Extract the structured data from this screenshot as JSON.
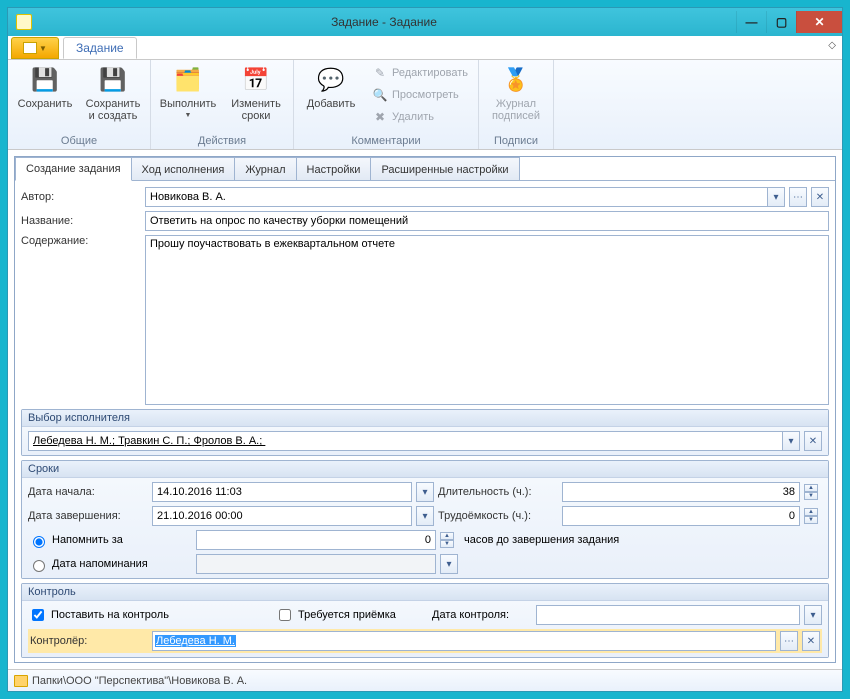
{
  "title": "Задание - Задание",
  "ribbon_tab": "Задание",
  "ribbon": {
    "save": "Сохранить",
    "save_create": "Сохранить\nи создать",
    "group_common": "Общие",
    "execute": "Выполнить",
    "change_dates": "Изменить\nсроки",
    "group_actions": "Действия",
    "add": "Добавить",
    "edit": "Редактировать",
    "view": "Просмотреть",
    "delete": "Удалить",
    "group_comments": "Комментарии",
    "siglog": "Журнал\nподписей",
    "group_sign": "Подписи"
  },
  "tabs": [
    "Создание задания",
    "Ход исполнения",
    "Журнал",
    "Настройки",
    "Расширенные настройки"
  ],
  "form": {
    "author_label": "Автор:",
    "author_value": "Новикова В. А.",
    "name_label": "Название:",
    "name_value": "Ответить на опрос по качеству уборки помещений",
    "content_label": "Содержание:",
    "content_value": "Прошу поучаствовать в ежеквартальном отчете"
  },
  "performers": {
    "title": "Выбор исполнителя",
    "value": "Лебедева Н. М.; Травкин С. П.; Фролов В. А.; "
  },
  "dates": {
    "title": "Сроки",
    "start_label": "Дата начала:",
    "start_value": "14.10.2016 11:03",
    "end_label": "Дата завершения:",
    "end_value": "21.10.2016 00:00",
    "duration_label": "Длительность (ч.):",
    "duration_value": "38",
    "labor_label": "Трудоёмкость (ч.):",
    "labor_value": "0",
    "remind_before": "Напомнить за",
    "remind_value": "0",
    "remind_suffix": "часов до завершения задания",
    "remind_date": "Дата напоминания"
  },
  "control": {
    "title": "Контроль",
    "put": "Поставить на контроль",
    "accept": "Требуется приёмка",
    "date_label": "Дата контроля:",
    "controller_label": "Контролёр:",
    "controller_value": "Лебедева Н. М."
  },
  "status_path": "Папки\\ООО \"Перспектива\"\\Новикова В. А."
}
